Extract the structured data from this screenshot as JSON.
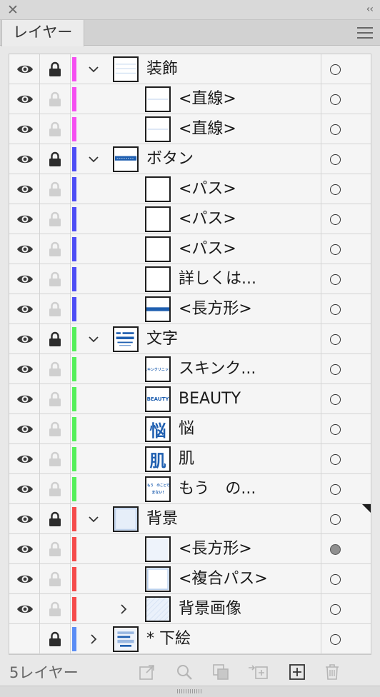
{
  "panel": {
    "close_glyph": "✕",
    "collapse_glyph": "‹‹",
    "tab_label": "レイヤー",
    "menu_icon": "hamburger-menu-icon"
  },
  "colors": {
    "magenta": "#f54ff1",
    "blue": "#4d4df5",
    "green": "#55f05a",
    "red": "#f54b4b",
    "light_blue": "#5a8df5",
    "thumb_blue": "#1f5fb0"
  },
  "layers": [
    {
      "name": "装飾",
      "level": 0,
      "expandable": true,
      "expanded": true,
      "color": "#f54ff1",
      "visible": true,
      "locked": true,
      "thumb": "lines",
      "target": "hollow"
    },
    {
      "name": "<直線>",
      "level": 1,
      "color": "#f54ff1",
      "visible": true,
      "locked": false,
      "thumb": "line-v",
      "target": "hollow"
    },
    {
      "name": "<直線>",
      "level": 1,
      "color": "#f54ff1",
      "visible": true,
      "locked": false,
      "thumb": "line-v",
      "target": "hollow"
    },
    {
      "name": "ボタン",
      "level": 0,
      "expandable": true,
      "expanded": true,
      "color": "#4d4df5",
      "visible": true,
      "locked": true,
      "thumb": "button",
      "target": "hollow"
    },
    {
      "name": "<パス>",
      "level": 1,
      "color": "#4d4df5",
      "visible": true,
      "locked": false,
      "thumb": "blank",
      "target": "hollow"
    },
    {
      "name": "<パス>",
      "level": 1,
      "color": "#4d4df5",
      "visible": true,
      "locked": false,
      "thumb": "blank",
      "target": "hollow"
    },
    {
      "name": "<パス>",
      "level": 1,
      "color": "#4d4df5",
      "visible": true,
      "locked": false,
      "thumb": "blank",
      "target": "hollow"
    },
    {
      "name": "詳しくは...",
      "level": 1,
      "color": "#4d4df5",
      "visible": true,
      "locked": false,
      "thumb": "blank",
      "target": "hollow"
    },
    {
      "name": "<長方形>",
      "level": 1,
      "color": "#4d4df5",
      "visible": true,
      "locked": false,
      "thumb": "bar",
      "target": "hollow"
    },
    {
      "name": "文字",
      "level": 0,
      "expandable": true,
      "expanded": true,
      "color": "#55f05a",
      "visible": true,
      "locked": true,
      "thumb": "text-group",
      "target": "hollow"
    },
    {
      "name": "スキンク...",
      "level": 1,
      "color": "#55f05a",
      "visible": true,
      "locked": false,
      "thumb": "small-text",
      "thumb_text": "スキンクリニック",
      "target": "hollow"
    },
    {
      "name": "BEAUTY",
      "level": 1,
      "color": "#55f05a",
      "visible": true,
      "locked": false,
      "thumb": "small-text",
      "thumb_text": "BEAUTY",
      "target": "hollow"
    },
    {
      "name": "悩",
      "level": 1,
      "color": "#55f05a",
      "visible": true,
      "locked": false,
      "thumb": "big-char",
      "thumb_text": "悩",
      "target": "hollow"
    },
    {
      "name": "肌",
      "level": 1,
      "color": "#55f05a",
      "visible": true,
      "locked": false,
      "thumb": "big-char",
      "thumb_text": "肌",
      "target": "hollow"
    },
    {
      "name": "もう　の...",
      "level": 1,
      "color": "#55f05a",
      "visible": true,
      "locked": false,
      "thumb": "two-lines",
      "thumb_text": "もう　のことで",
      "thumb_text2": "まない!",
      "target": "hollow"
    },
    {
      "name": "背景",
      "level": 0,
      "expandable": true,
      "expanded": true,
      "color": "#f54b4b",
      "visible": true,
      "locked": true,
      "thumb": "bg",
      "target": "hollow",
      "corner": true
    },
    {
      "name": "<長方形>",
      "level": 1,
      "color": "#f54b4b",
      "visible": true,
      "locked": false,
      "thumb": "rect-light",
      "target": "filled"
    },
    {
      "name": "<複合パス>",
      "level": 1,
      "color": "#f54b4b",
      "visible": true,
      "locked": false,
      "thumb": "rect-border",
      "target": "hollow"
    },
    {
      "name": "背景画像",
      "level": 1,
      "expandable": true,
      "expanded": false,
      "color": "#f54b4b",
      "visible": true,
      "locked": false,
      "thumb": "pattern",
      "target": "hollow"
    },
    {
      "name": "* 下絵",
      "level": 0,
      "expandable": true,
      "expanded": false,
      "color": "#5a8df5",
      "visible": false,
      "locked": true,
      "thumb": "sketch",
      "target": "hollow"
    }
  ],
  "footer": {
    "count_label": "5レイヤー",
    "icons": [
      "export-icon",
      "search-icon",
      "clipping-mask-icon",
      "move-to-layer-icon",
      "new-layer-icon",
      "trash-icon"
    ]
  }
}
